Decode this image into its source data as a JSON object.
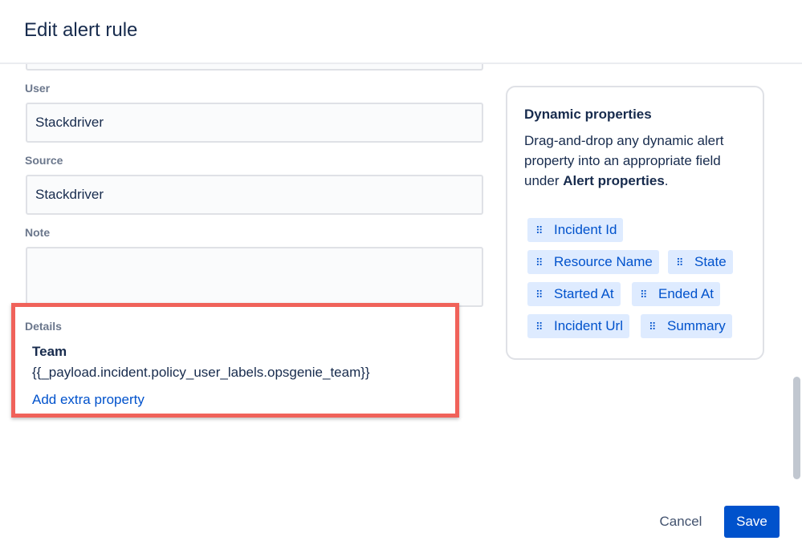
{
  "modal": {
    "title": "Edit alert rule"
  },
  "form": {
    "user": {
      "label": "User",
      "value": "Stackdriver"
    },
    "source": {
      "label": "Source",
      "value": "Stackdriver"
    },
    "note": {
      "label": "Note",
      "value": ""
    },
    "details": {
      "label": "Details",
      "key": "Team",
      "value": "{{_payload.incident.policy_user_labels.opsgenie_team}}",
      "add_link": "Add extra property",
      "highlight_color": "#f0625a"
    }
  },
  "dynamic_properties": {
    "title": "Dynamic properties",
    "description_prefix": "Drag-and-drop any dynamic alert property into an appropriate field under ",
    "description_bold": "Alert properties",
    "description_suffix": ".",
    "chips": [
      {
        "label": "Incident Id"
      },
      {
        "label": "Resource Name"
      },
      {
        "label": "State"
      },
      {
        "label": "Started At"
      },
      {
        "label": "Ended At"
      },
      {
        "label": "Incident Url"
      },
      {
        "label": "Summary"
      }
    ]
  },
  "footer": {
    "cancel_label": "Cancel",
    "save_label": "Save"
  },
  "colors": {
    "primary": "#0052cc",
    "chip_bg": "#deebff",
    "text": "#172b4d",
    "label": "#6b778c"
  }
}
